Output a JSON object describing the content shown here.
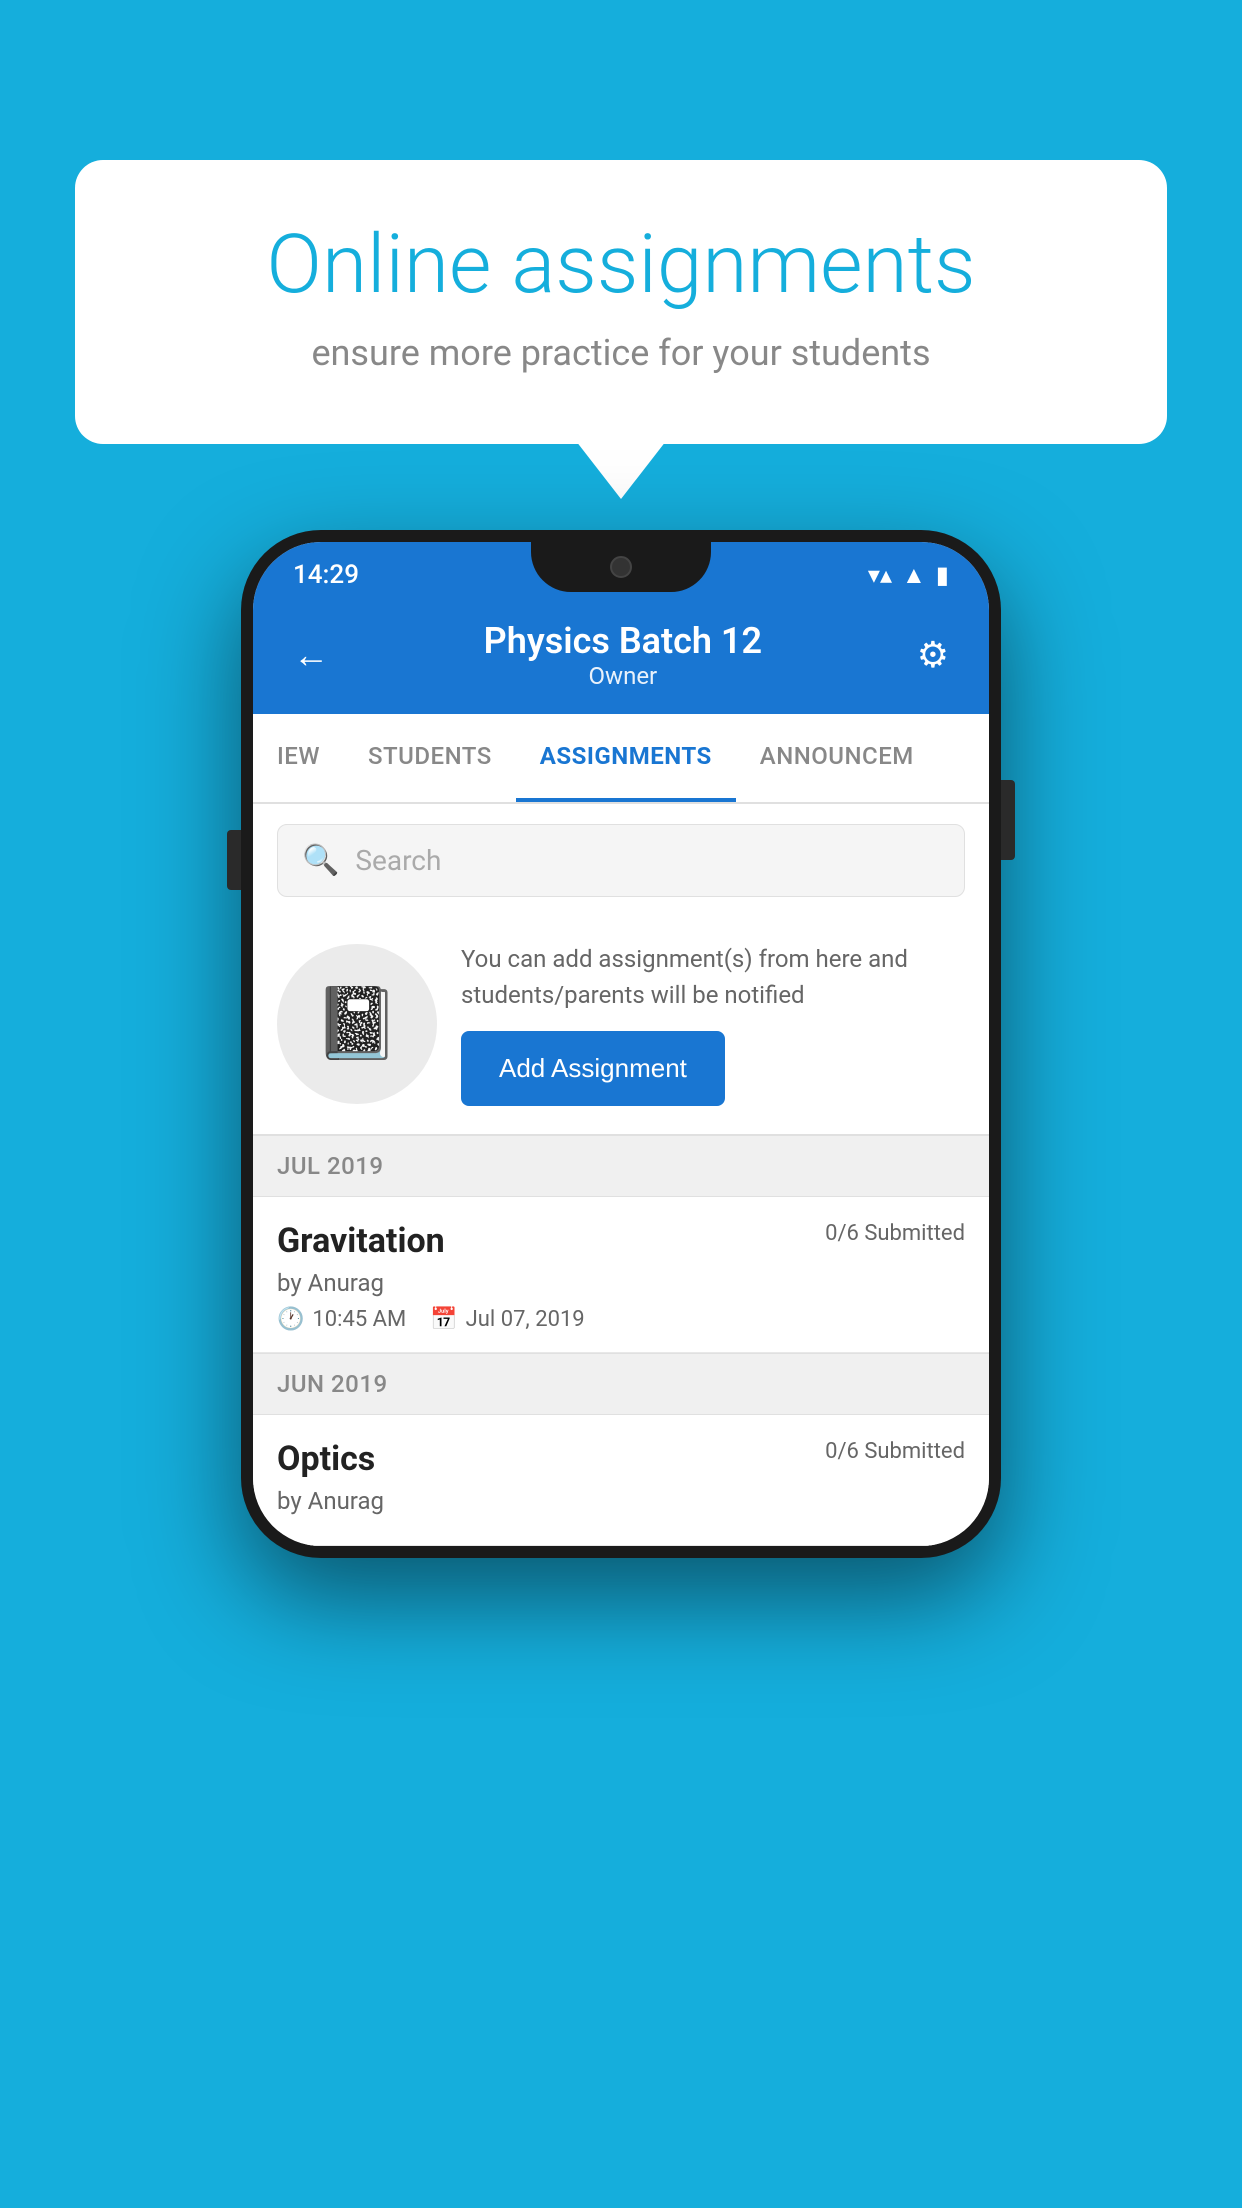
{
  "background_color": "#15AEDC",
  "speech_bubble": {
    "title": "Online assignments",
    "subtitle": "ensure more practice for your students"
  },
  "phone": {
    "status_bar": {
      "time": "14:29",
      "wifi": "▼",
      "signal": "▲",
      "battery": "▮"
    },
    "header": {
      "title": "Physics Batch 12",
      "subtitle": "Owner",
      "back_label": "←",
      "settings_label": "⚙"
    },
    "tabs": [
      {
        "label": "IEW",
        "active": false
      },
      {
        "label": "STUDENTS",
        "active": false
      },
      {
        "label": "ASSIGNMENTS",
        "active": true
      },
      {
        "label": "ANNOUNCEM",
        "active": false
      }
    ],
    "search": {
      "placeholder": "Search"
    },
    "promo": {
      "text": "You can add assignment(s) from here and students/parents will be notified",
      "button_label": "Add Assignment"
    },
    "sections": [
      {
        "month": "JUL 2019",
        "assignments": [
          {
            "title": "Gravitation",
            "submitted": "0/6 Submitted",
            "author": "by Anurag",
            "time": "10:45 AM",
            "date": "Jul 07, 2019"
          }
        ]
      },
      {
        "month": "JUN 2019",
        "assignments": [
          {
            "title": "Optics",
            "submitted": "0/6 Submitted",
            "author": "by Anurag",
            "time": "",
            "date": ""
          }
        ]
      }
    ]
  }
}
